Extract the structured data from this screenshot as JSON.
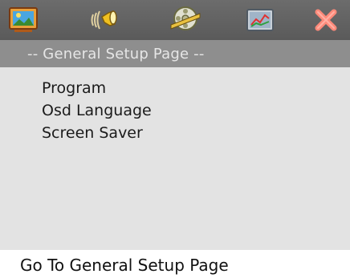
{
  "toolbar": {
    "tabs": [
      {
        "icon": "picture-icon"
      },
      {
        "icon": "speaker-icon"
      },
      {
        "icon": "film-reel-icon"
      },
      {
        "icon": "chart-icon"
      },
      {
        "icon": "close-x-icon"
      }
    ]
  },
  "header": {
    "title": "-- General Setup Page --"
  },
  "menu": {
    "items": [
      {
        "label": "Program"
      },
      {
        "label": "Osd Language"
      },
      {
        "label": "Screen Saver"
      }
    ]
  },
  "footer": {
    "status": "Go To General Setup Page"
  },
  "colors": {
    "topbar": "#606060",
    "header": "#8e8e8e",
    "content": "#e3e3e3",
    "close": "#ff8a7a"
  }
}
